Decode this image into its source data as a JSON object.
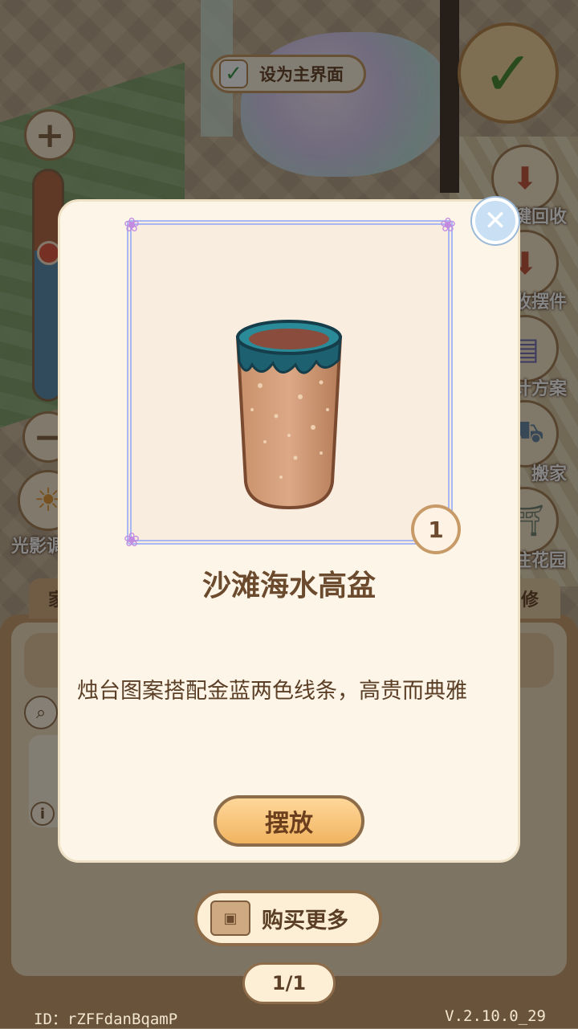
{
  "topbar": {
    "set_home_label": "设为主界面",
    "set_home_checked": true
  },
  "zoom": {
    "level": 0.35
  },
  "left_tools": {
    "light_label": "光影调"
  },
  "side_menu": [
    {
      "label": "一键回收",
      "icon": "recycle-box-icon"
    },
    {
      "label": "收摆件",
      "icon": "store-items-icon"
    },
    {
      "label": "设计方案",
      "icon": "blueprint-icon"
    },
    {
      "label": "搬家",
      "icon": "moving-truck-icon"
    },
    {
      "label": "前往花园",
      "icon": "garden-gate-icon"
    }
  ],
  "panel_tabs": {
    "left": "家",
    "right": "修"
  },
  "modal": {
    "item_name": "沙滩海水高盆",
    "quantity": "1",
    "description": "烛台图案搭配金蓝两色线条，高贵而典雅",
    "place_button": "摆放",
    "close_icon": "close-icon"
  },
  "bottom": {
    "buy_more": "购买更多",
    "page": "1/1",
    "player_id": "ID：rZFFdanBqamP",
    "version": "V.2.10.0_29"
  },
  "colors": {
    "modal_bg": "#fdf6e8",
    "button_orange": "#f0b460",
    "text_brown": "#6b4a2e",
    "frame_lilac": "#a9b8f2"
  }
}
